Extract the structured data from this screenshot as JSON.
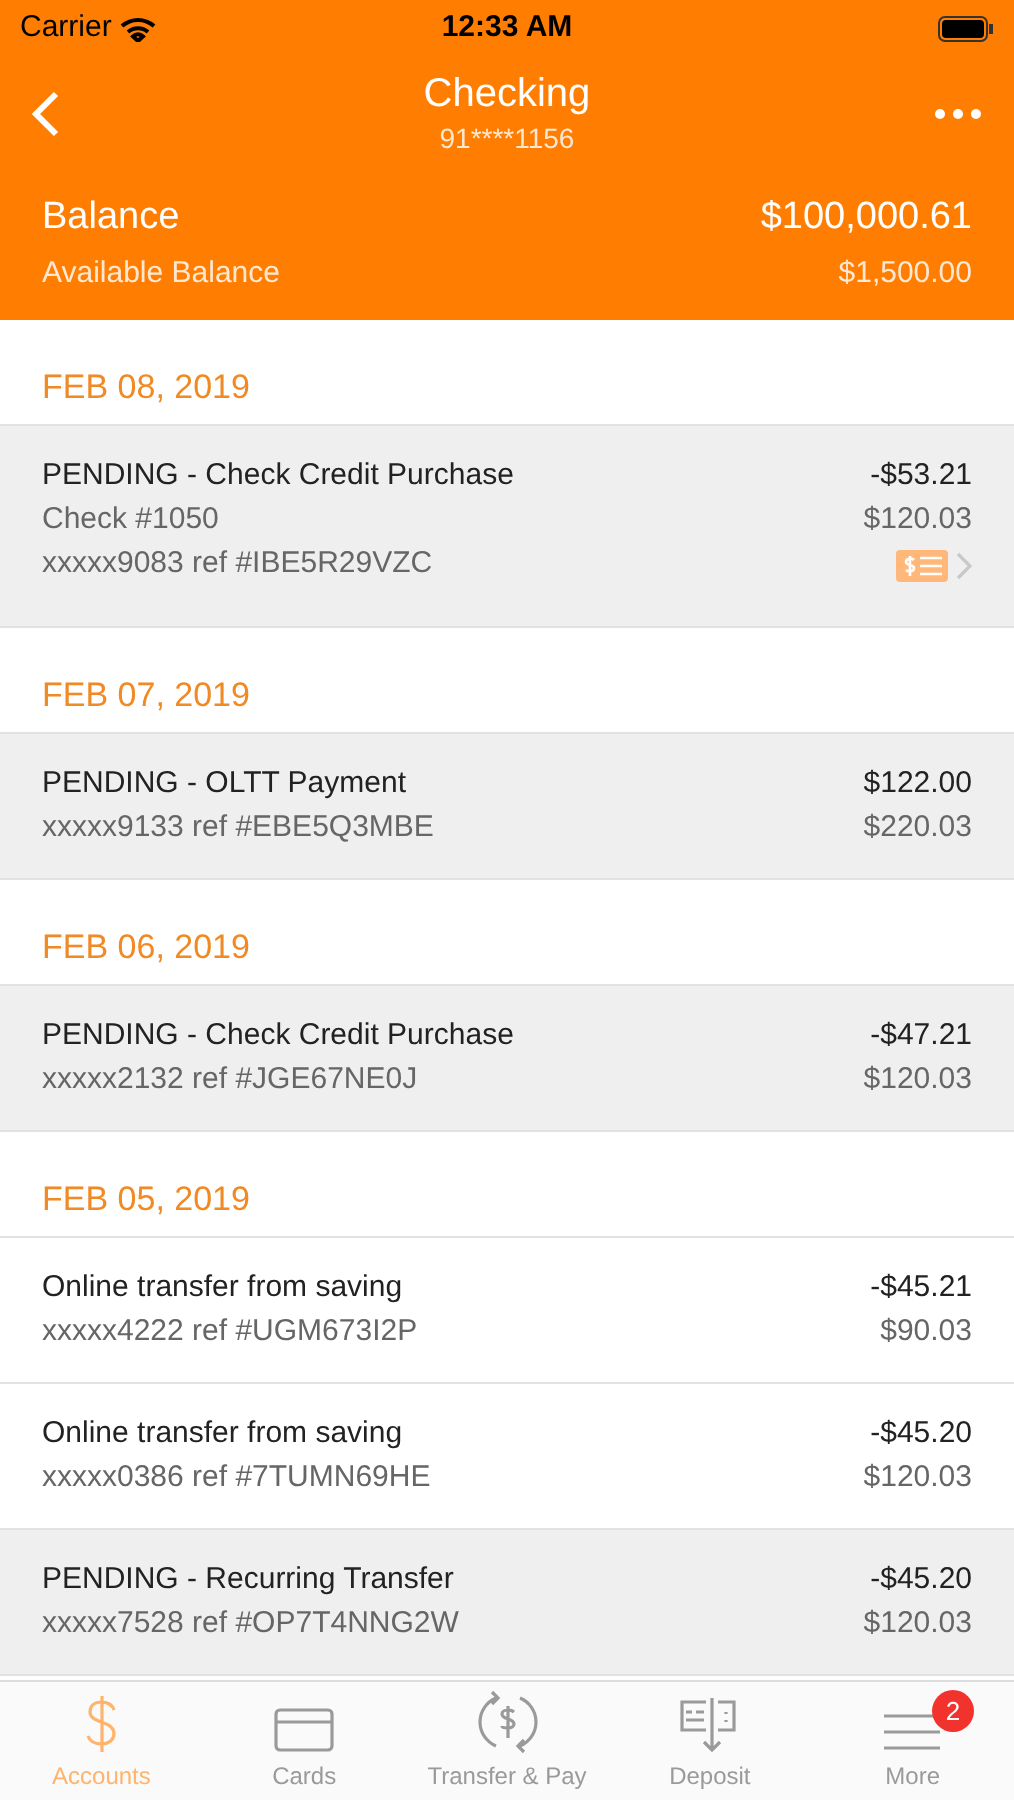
{
  "status_bar": {
    "carrier": "Carrier",
    "time": "12:33 AM"
  },
  "nav": {
    "title": "Checking",
    "subtitle": "91****1156"
  },
  "balance": {
    "label": "Balance",
    "amount": "$100,000.61",
    "available_label": "Available Balance",
    "available_amount": "$1,500.00"
  },
  "groups": [
    {
      "date": "FEB 08, 2019",
      "transactions": [
        {
          "title": "PENDING - Check Credit Purchase",
          "lines": [
            "Check #1050",
            "xxxxx9083 ref #IBE5R29VZC"
          ],
          "amount": "-$53.21",
          "balance": "$120.03",
          "pending": true,
          "has_check_image": true
        }
      ]
    },
    {
      "date": "FEB 07, 2019",
      "transactions": [
        {
          "title": "PENDING - OLTT Payment",
          "lines": [
            "xxxxx9133 ref #EBE5Q3MBE"
          ],
          "amount": "$122.00",
          "balance": "$220.03",
          "pending": true,
          "has_check_image": false
        }
      ]
    },
    {
      "date": "FEB 06, 2019",
      "transactions": [
        {
          "title": "PENDING - Check Credit Purchase",
          "lines": [
            "xxxxx2132 ref #JGE67NE0J"
          ],
          "amount": "-$47.21",
          "balance": "$120.03",
          "pending": true,
          "has_check_image": false
        }
      ]
    },
    {
      "date": "FEB 05, 2019",
      "transactions": [
        {
          "title": "Online transfer from saving",
          "lines": [
            "xxxxx4222 ref #UGM673I2P"
          ],
          "amount": "-$45.21",
          "balance": "$90.03",
          "pending": false,
          "has_check_image": false
        },
        {
          "title": "Online transfer from saving",
          "lines": [
            "xxxxx0386 ref #7TUMN69HE"
          ],
          "amount": "-$45.20",
          "balance": "$120.03",
          "pending": false,
          "has_check_image": false
        },
        {
          "title": "PENDING - Recurring Transfer",
          "lines": [
            "xxxxx7528 ref #OP7T4NNG2W"
          ],
          "amount": "-$45.20",
          "balance": "$120.03",
          "pending": true,
          "has_check_image": false
        }
      ]
    }
  ],
  "tabs": [
    {
      "kind": "accounts",
      "label": "Accounts",
      "selected": true
    },
    {
      "kind": "cards",
      "label": "Cards",
      "selected": false
    },
    {
      "kind": "transfer",
      "label": "Transfer & Pay",
      "selected": false
    },
    {
      "kind": "deposit",
      "label": "Deposit",
      "selected": false
    },
    {
      "kind": "more",
      "label": "More",
      "selected": false,
      "badge": "2"
    }
  ]
}
